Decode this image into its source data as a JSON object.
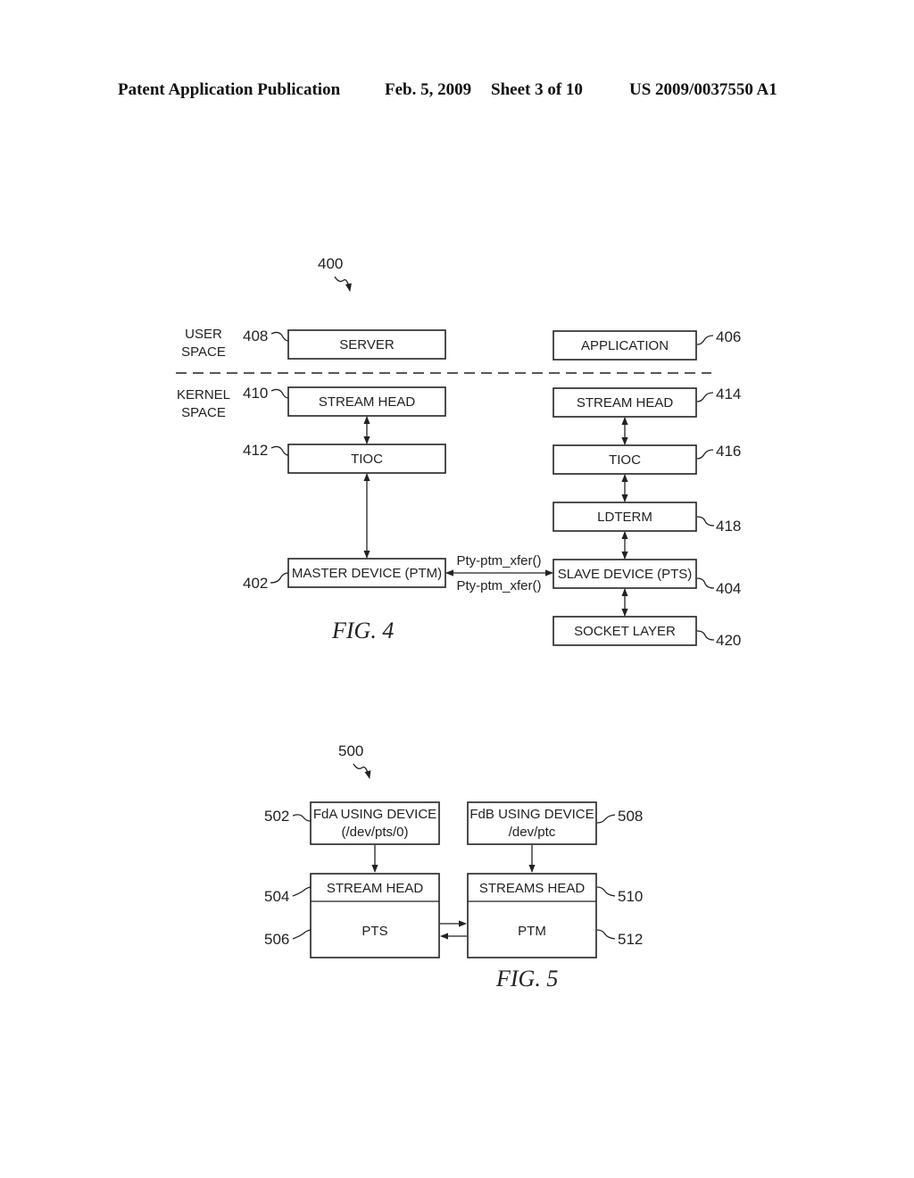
{
  "header": {
    "publication": "Patent Application Publication",
    "date": "Feb. 5, 2009",
    "sheet": "Sheet 3 of 10",
    "number": "US 2009/0037550 A1"
  },
  "fig4": {
    "ref": "400",
    "caption": "FIG. 4",
    "user_space": [
      "USER",
      "SPACE"
    ],
    "kernel_space": [
      "KERNEL",
      "SPACE"
    ],
    "server": {
      "label": "SERVER",
      "ref": "408"
    },
    "application": {
      "label": "APPLICATION",
      "ref": "406"
    },
    "stream_head_left": {
      "label": "STREAM HEAD",
      "ref": "410"
    },
    "stream_head_right": {
      "label": "STREAM HEAD",
      "ref": "414"
    },
    "tioc_left": {
      "label": "TIOC",
      "ref": "412"
    },
    "tioc_right": {
      "label": "TIOC",
      "ref": "416"
    },
    "ldterm": {
      "label": "LDTERM",
      "ref": "418"
    },
    "master": {
      "label": "MASTER DEVICE (PTM)",
      "ref": "402"
    },
    "slave": {
      "label": "SLAVE DEVICE (PTS)",
      "ref": "404"
    },
    "socket": {
      "label": "SOCKET LAYER",
      "ref": "420"
    },
    "xfer_top": "Pty-ptm_xfer()",
    "xfer_bottom": "Pty-ptm_xfer()"
  },
  "fig5": {
    "ref": "500",
    "caption": "FIG. 5",
    "fda": {
      "line1": "FdA USING DEVICE",
      "line2": "(/dev/pts/0)",
      "ref": "502"
    },
    "fdb": {
      "line1": "FdB USING DEVICE",
      "line2": "/dev/ptc",
      "ref": "508"
    },
    "stream_head": {
      "label": "STREAM HEAD",
      "ref": "504"
    },
    "pts": {
      "label": "PTS",
      "ref": "506"
    },
    "streams_head": {
      "label": "STREAMS HEAD",
      "ref": "510"
    },
    "ptm": {
      "label": "PTM",
      "ref": "512"
    }
  }
}
